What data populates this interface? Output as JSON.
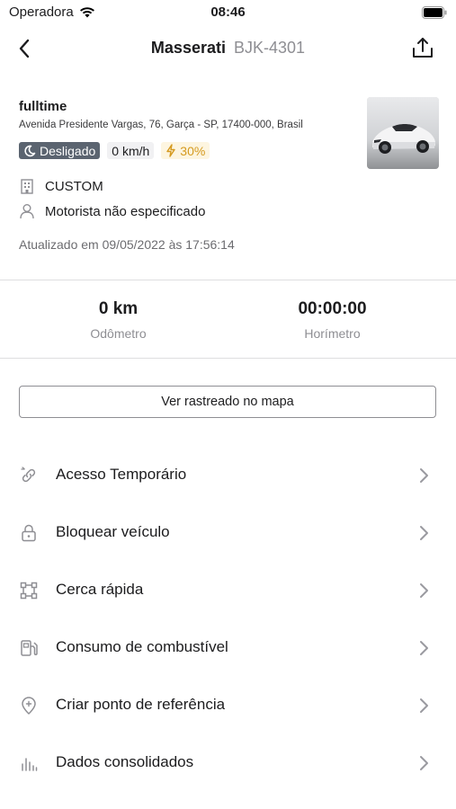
{
  "status_bar": {
    "carrier": "Operadora",
    "time": "08:46"
  },
  "header": {
    "model": "Masserati",
    "plate": "BJK-4301"
  },
  "vehicle": {
    "account": "fulltime",
    "address": "Avenida Presidente Vargas, 76, Garça - SP, 17400-000, Brasil",
    "status": "Desligado",
    "speed": "0 km/h",
    "battery": "30%",
    "group": "CUSTOM",
    "driver": "Motorista não especificado",
    "updated": "Atualizado em 09/05/2022 às 17:56:14"
  },
  "stats": {
    "odometer_value": "0 km",
    "odometer_label": "Odômetro",
    "hourmeter_value": "00:00:00",
    "hourmeter_label": "Horímetro"
  },
  "map_button": "Ver rastreado no mapa",
  "menu": [
    {
      "label": "Acesso Temporário",
      "icon": "link-icon"
    },
    {
      "label": "Bloquear veículo",
      "icon": "lock-icon"
    },
    {
      "label": "Cerca rápida",
      "icon": "fence-icon"
    },
    {
      "label": "Consumo de combustível",
      "icon": "fuel-icon"
    },
    {
      "label": "Criar ponto de referência",
      "icon": "location-pin-icon"
    },
    {
      "label": "Dados consolidados",
      "icon": "bar-chart-icon"
    }
  ],
  "colors": {
    "status_badge": "#5b6470",
    "battery_text": "#d59a1f",
    "battery_bg": "#fdf5e0",
    "icon_gray": "#8e8e93"
  }
}
